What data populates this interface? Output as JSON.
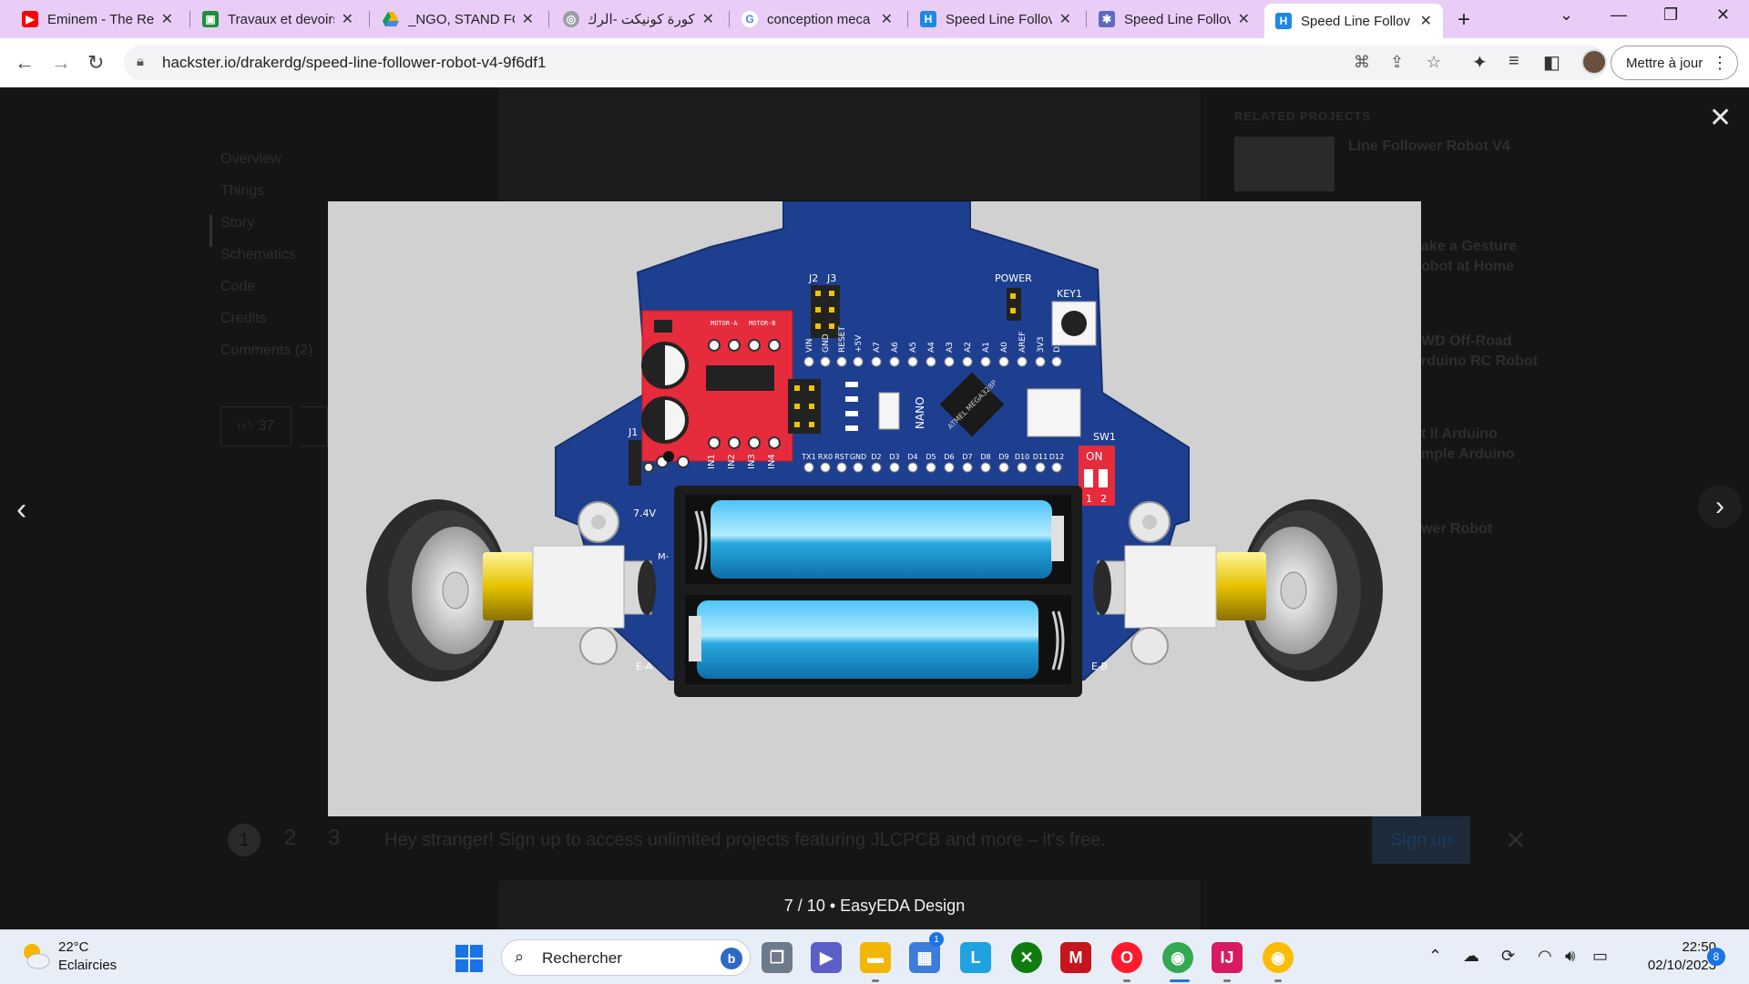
{
  "browser": {
    "tabs": [
      {
        "title": "Eminem - The Re",
        "favicon": "youtube-icon",
        "color": "#ff0000"
      },
      {
        "title": "Travaux et devoirs",
        "favicon": "classroom-icon",
        "color": "#1e8e3e"
      },
      {
        "title": "_NGO, STAND FO",
        "favicon": "drive-icon",
        "color": "#f4b400"
      },
      {
        "title": "كورة كونيكت -الرك",
        "favicon": "globe-icon",
        "color": "#9aa0a6"
      },
      {
        "title": "conception meca",
        "favicon": "google-icon",
        "color": "#4285f4"
      },
      {
        "title": "Speed Line Follov",
        "favicon": "hackster-icon",
        "color": "#1e88e5"
      },
      {
        "title": "Speed Line Follov",
        "favicon": "easyeda-icon",
        "color": "#5c6bc0"
      },
      {
        "title": "Speed Line Follov",
        "favicon": "hackster-icon",
        "color": "#1e88e5"
      }
    ],
    "url": "hackster.io/drakerdg/speed-line-follower-robot-v4-9f6df1",
    "update_button": "Mettre à jour"
  },
  "page": {
    "side_nav": [
      "Overview",
      "Things",
      "Story",
      "Schematics",
      "Code",
      "Credits",
      "Comments (2)"
    ],
    "respect_count": "37",
    "related_header": "RELATED PROJECTS",
    "related": [
      "Line Follower Robot V4",
      "ake a Gesture",
      "obot at Home",
      "WD Off-Road",
      "rduino RC Robot",
      "t ll Arduino",
      "mple Arduino",
      "wer Robot"
    ],
    "banner": {
      "pages": [
        "1",
        "2",
        "3"
      ],
      "message": "Hey stranger! Sign up to access unlimited projects featuring JLCPCB and more – it's free.",
      "button": "Sign up"
    }
  },
  "lightbox": {
    "caption": "7 / 10 • EasyEDA Design",
    "pcb_labels": {
      "j2": "J2",
      "j3": "J3",
      "power": "POWER",
      "key1": "KEY1",
      "sw1": "SW1",
      "on": "ON",
      "j1": "J1",
      "v74": "7.4V",
      "ea": "E-A",
      "eb": "E-B",
      "m": "M-",
      "nano": "NANO",
      "chip": "ATMEL MEGA328P",
      "top_pins": [
        "VIN",
        "GND",
        "RESET",
        "+5V",
        "A7",
        "A6",
        "A5",
        "A4",
        "A3",
        "A2",
        "A1",
        "A0",
        "AREF",
        "3V3",
        "D13/SCK"
      ],
      "bottom_pins": [
        "TX1",
        "RX0",
        "RST",
        "GND",
        "D2",
        "D3",
        "D4",
        "D5",
        "D6",
        "D7",
        "D8",
        "D9",
        "D10",
        "D11",
        "D12"
      ],
      "driver_in": [
        "IN1",
        "IN2",
        "IN3",
        "IN4"
      ],
      "driver_motor": [
        "MOTOR-A",
        "MOTOR-B"
      ],
      "sw_nums": [
        "1",
        "2"
      ]
    }
  },
  "taskbar": {
    "weather_temp": "22°C",
    "weather_desc": "Eclaircies",
    "search": "Rechercher",
    "time": "22:50",
    "date": "02/10/2023",
    "notifications": "8",
    "store_badge": "1"
  }
}
